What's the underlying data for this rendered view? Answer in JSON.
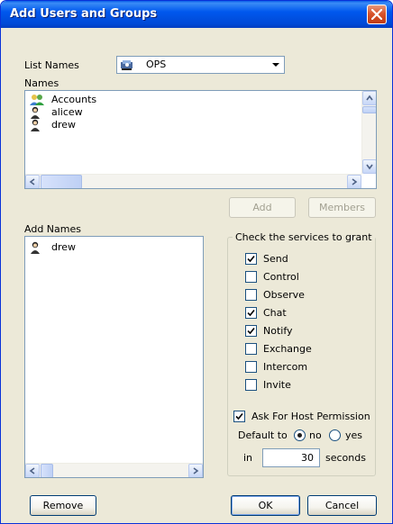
{
  "window": {
    "title": "Add Users and Groups"
  },
  "list_names": {
    "label": "List Names",
    "selected": "OPS",
    "icon": "group-list-icon"
  },
  "names": {
    "label": "Names",
    "items": [
      {
        "text": "Accounts",
        "icon": "group-icon"
      },
      {
        "text": "alicew",
        "icon": "user-icon"
      },
      {
        "text": "drew",
        "icon": "user-icon"
      }
    ]
  },
  "buttons": {
    "add": "Add",
    "members": "Members",
    "remove": "Remove",
    "ok": "OK",
    "cancel": "Cancel"
  },
  "add_names": {
    "label": "Add Names",
    "items": [
      {
        "text": "drew",
        "icon": "user-icon"
      }
    ]
  },
  "services": {
    "title": "Check the services to grant",
    "items": [
      {
        "label": "Send",
        "checked": true
      },
      {
        "label": "Control",
        "checked": false
      },
      {
        "label": "Observe",
        "checked": false
      },
      {
        "label": "Chat",
        "checked": true
      },
      {
        "label": "Notify",
        "checked": true
      },
      {
        "label": "Exchange",
        "checked": false
      },
      {
        "label": "Intercom",
        "checked": false
      },
      {
        "label": "Invite",
        "checked": false
      }
    ]
  },
  "host_permission": {
    "label": "Ask For Host Permission",
    "checked": true,
    "default_label": "Default to",
    "options": [
      "no",
      "yes"
    ],
    "selected": "no",
    "in_label": "in",
    "seconds_value": "30",
    "seconds_label": "seconds"
  },
  "colors": {
    "title_bar": "#0058ee",
    "dialog_bg": "#ece9d8",
    "close_button": "#d8542c"
  }
}
